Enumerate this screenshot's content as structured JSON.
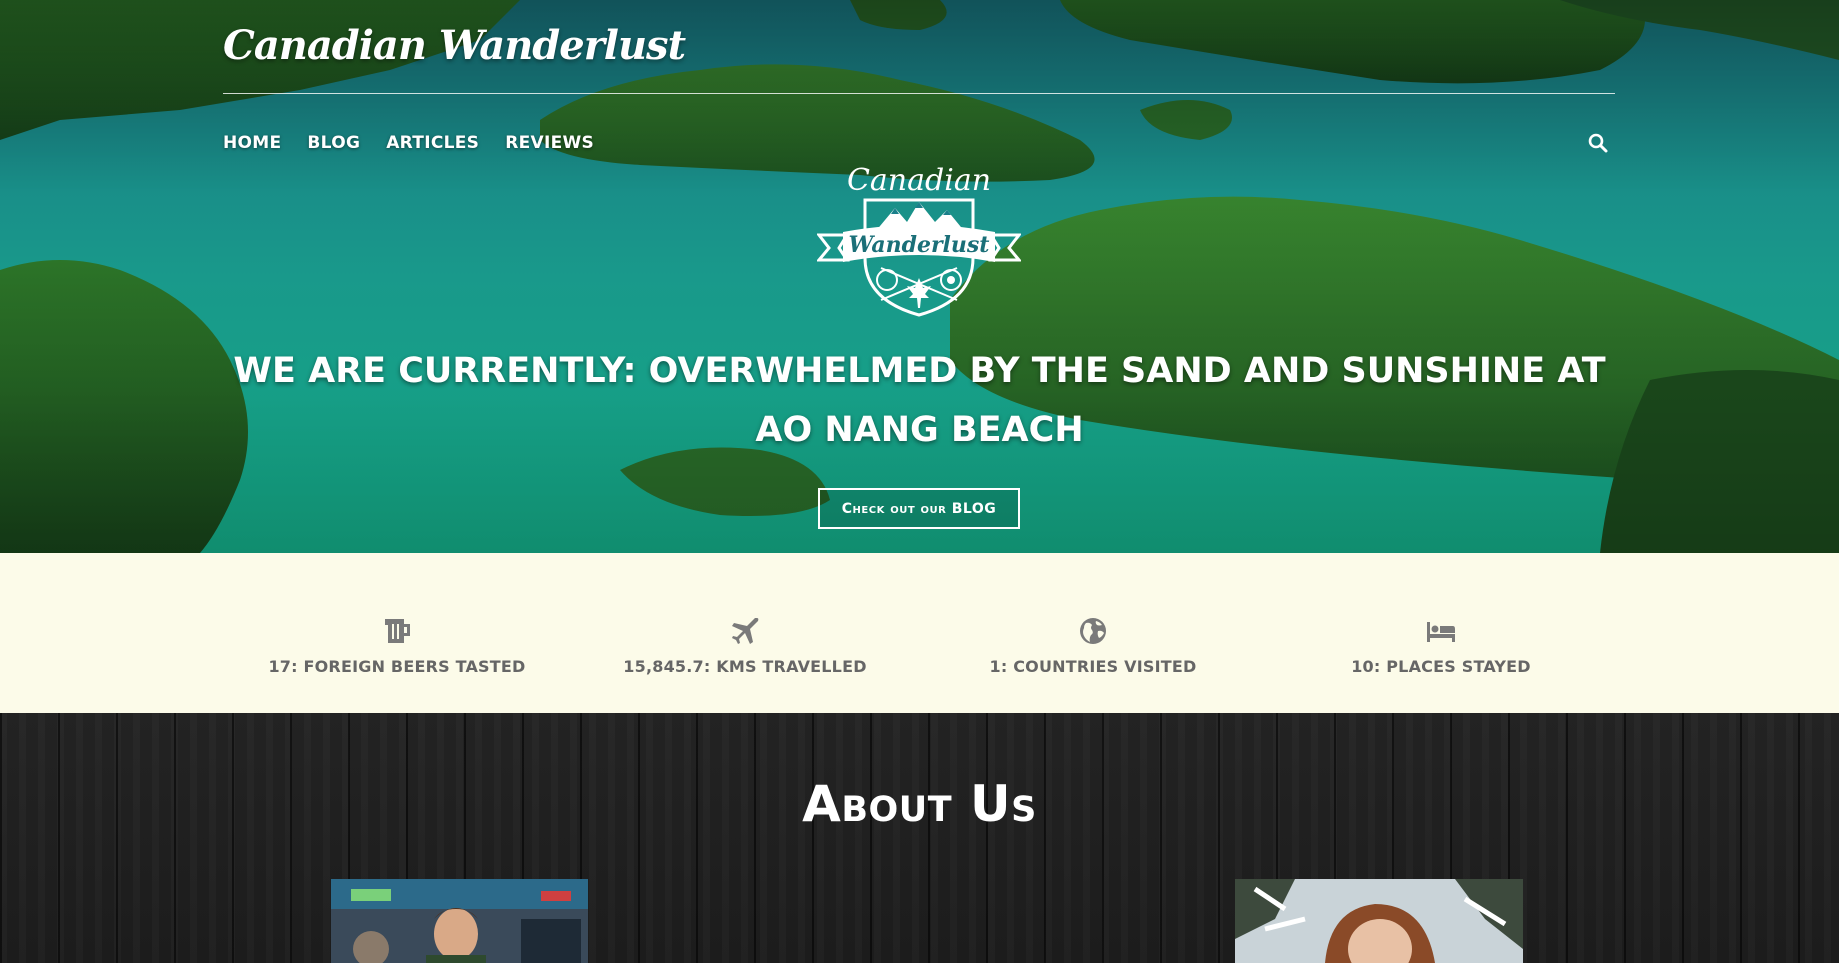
{
  "header": {
    "brand": "Canadian Wanderlust",
    "nav": [
      {
        "label": "HOME"
      },
      {
        "label": "BLOG"
      },
      {
        "label": "ARTICLES"
      },
      {
        "label": "REVIEWS"
      }
    ],
    "search_icon": "search-icon"
  },
  "logo": {
    "line1": "Canadian",
    "line2": "Wanderlust"
  },
  "hero": {
    "headline": "WE ARE CURRENTLY: OVERWHELMED BY THE SAND AND SUNSHINE AT AO NANG BEACH",
    "cta_label": "Check out our BLOG"
  },
  "stats": [
    {
      "icon": "beer-mug-icon",
      "label": "17: FOREIGN BEERS TASTED"
    },
    {
      "icon": "plane-icon",
      "label": "15,845.7: KMS TRAVELLED"
    },
    {
      "icon": "globe-icon",
      "label": "1: COUNTRIES VISITED"
    },
    {
      "icon": "bed-icon",
      "label": "10: PLACES STAYED"
    }
  ],
  "about": {
    "title": "About Us"
  },
  "colors": {
    "stats_bg": "#fcfbe9",
    "stats_text": "#666666",
    "about_bg": "#202020"
  }
}
